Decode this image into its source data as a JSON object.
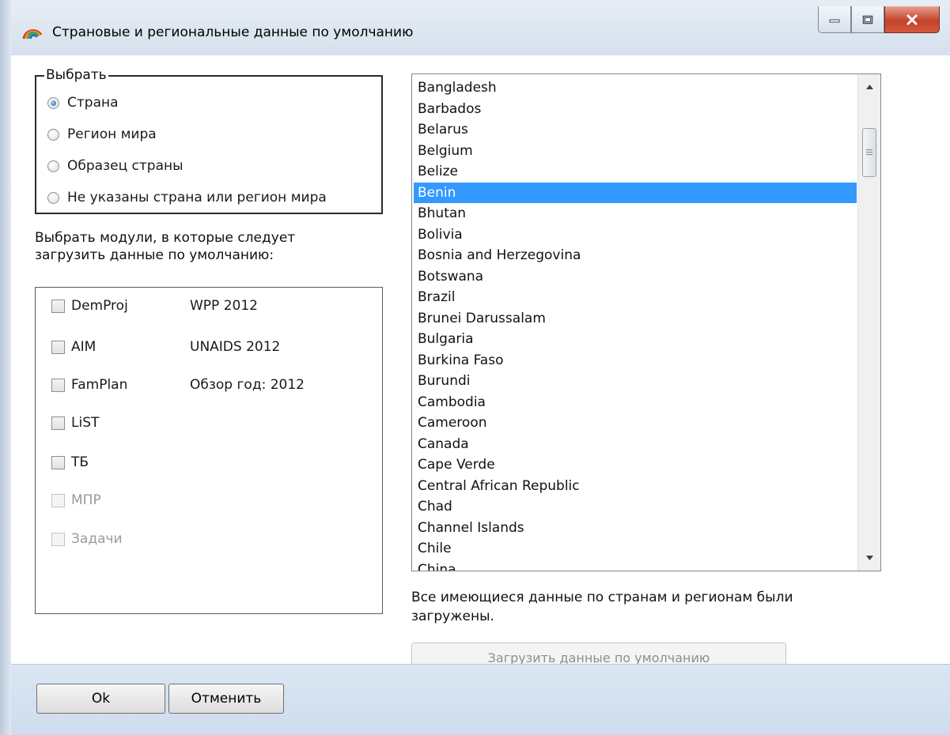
{
  "window": {
    "title": "Страновые и региональные данные по умолчанию",
    "controls": [
      "minimize-icon",
      "maximize-icon",
      "close-icon"
    ]
  },
  "select_group": {
    "legend": "Выбрать",
    "options": [
      {
        "label": "Страна",
        "checked": true
      },
      {
        "label": "Регион мира",
        "checked": false
      },
      {
        "label": "Образец страны",
        "checked": false
      },
      {
        "label": "Не указаны страна или регион мира",
        "checked": false
      }
    ]
  },
  "modules": {
    "caption": "Выбрать модули, в которые следует загрузить данные по умолчанию:",
    "items": [
      {
        "name": "DemProj",
        "source": "WPP 2012",
        "checked": false,
        "enabled": true
      },
      {
        "name": "AIM",
        "source": "UNAIDS 2012",
        "checked": false,
        "enabled": true
      },
      {
        "name": "FamPlan",
        "source": "Обзор год: 2012",
        "checked": false,
        "enabled": true
      },
      {
        "name": "LiST",
        "source": "",
        "checked": false,
        "enabled": true
      },
      {
        "name": "ТБ",
        "source": "",
        "checked": false,
        "enabled": true
      },
      {
        "name": "МПР",
        "source": "",
        "checked": false,
        "enabled": false
      },
      {
        "name": "Задачи",
        "source": "",
        "checked": false,
        "enabled": false
      }
    ]
  },
  "countries": {
    "items": [
      "Bangladesh",
      "Barbados",
      "Belarus",
      "Belgium",
      "Belize",
      "Benin",
      "Bhutan",
      "Bolivia",
      "Bosnia and Herzegovina",
      "Botswana",
      "Brazil",
      "Brunei Darussalam",
      "Bulgaria",
      "Burkina Faso",
      "Burundi",
      "Cambodia",
      "Cameroon",
      "Canada",
      "Cape Verde",
      "Central African Republic",
      "Chad",
      "Channel Islands",
      "Chile",
      "China"
    ],
    "selected": "Benin"
  },
  "status": "Все имеющиеся данные по странам и регионам были загружены.",
  "buttons": {
    "load_defaults": "Загрузить данные по умолчанию",
    "ok": "Ok",
    "cancel": "Отменить"
  },
  "colors": {
    "selection": "#3399ff",
    "footer": "#d6e1ee",
    "close_button": "#c4422a"
  }
}
